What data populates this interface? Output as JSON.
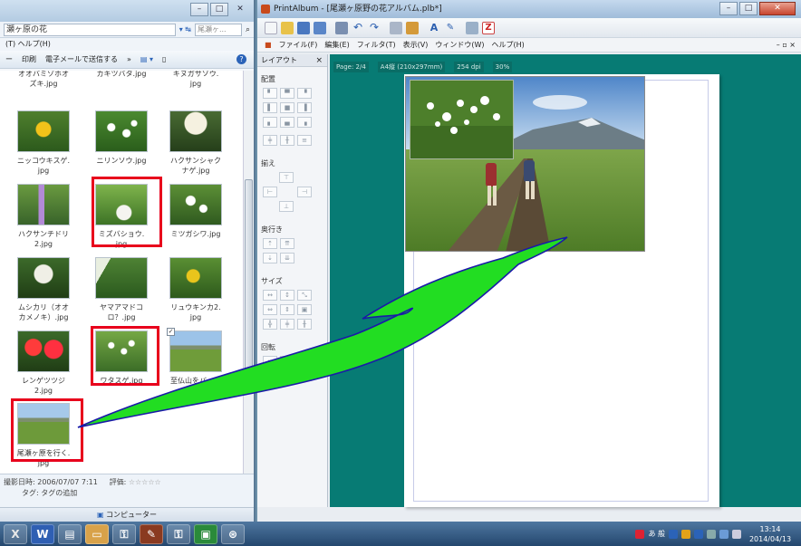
{
  "explorer": {
    "address": "瀬ヶ原の花",
    "search_placeholder": "尾瀬ヶ...",
    "menu": "(T)  ヘルプ(H)",
    "toolbar": {
      "item1": "ー",
      "print": "印刷",
      "email": "電子メールで送信する",
      "help": "?"
    },
    "thumbnails": [
      {
        "caption": "オオバミゾホオ\nズキ.jpg"
      },
      {
        "caption": "カキツバタ.jpg"
      },
      {
        "caption": "キヌガサソウ.\njpg"
      },
      {
        "caption": "ニッコウキスゲ.\njpg"
      },
      {
        "caption": "ニリンソウ.jpg"
      },
      {
        "caption": "ハクサンシャク\nナゲ.jpg"
      },
      {
        "caption": "ハクサンチドリ\n2.jpg"
      },
      {
        "caption": "ミズバショウ.\njpg"
      },
      {
        "caption": "ミツガシワ.jpg"
      },
      {
        "caption": "ムシカリ（オオ\nカメノキ）.jpg"
      },
      {
        "caption": "ヤマアマドコ\nロ？.jpg"
      },
      {
        "caption": "リュウキンカ2.\njpg"
      },
      {
        "caption": "レンゲツツジ\n2.jpg"
      },
      {
        "caption": "ワタスゲ.jpg"
      },
      {
        "caption": "至仏山をバック\nに.jpg"
      },
      {
        "caption": "尾瀬ヶ原を行く.\njpg"
      }
    ],
    "details": {
      "shot_date": "撮影日時: 2006/07/07 7:11",
      "rating": "評価:",
      "stars": "☆☆☆☆☆",
      "tags": "タグ: タグの追加"
    },
    "status": "コンピューター"
  },
  "printalbum": {
    "title": "PrintAlbum - [尾瀬ヶ原野の花アルバム.plb*]",
    "menu": [
      "ファイル(F)",
      "編集(E)",
      "フィルタ(T)",
      "表示(V)",
      "ウィンドウ(W)",
      "ヘルプ(H)"
    ],
    "panel_title": "レイアウト",
    "groups": [
      "配置",
      "揃え",
      "奥行き",
      "サイズ",
      "回転"
    ],
    "canvas_info": {
      "page": "Page: 2/4",
      "size": "A4縦 (210x297mm)",
      "dpi": "254 dpi",
      "zoom": "30%"
    }
  },
  "taskbar": {
    "clock_time": "13:14",
    "clock_date": "2014/04/13",
    "tray_text": "あ 般"
  },
  "colors": {
    "canvas": "#077b74",
    "arrow_fill": "#22dd22",
    "arrow_stroke": "#1a1aa8",
    "highlight": "#e8001c"
  }
}
